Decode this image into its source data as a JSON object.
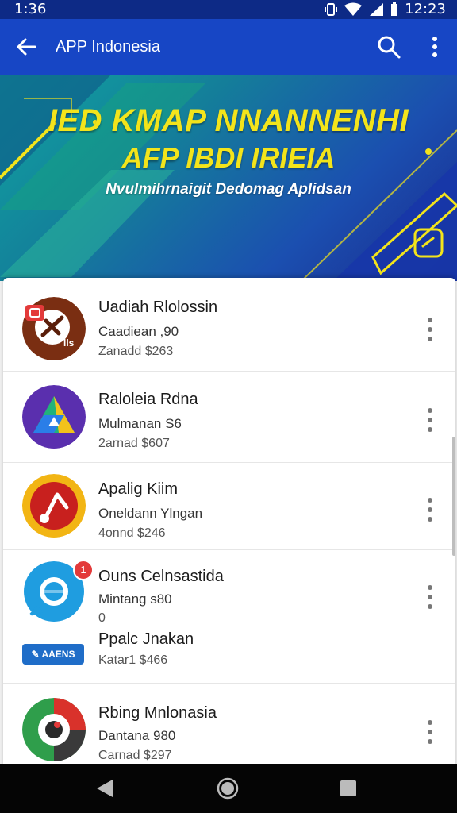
{
  "status_bar": {
    "time_left": "1:36",
    "time_right": "12:23",
    "icons": [
      "vibrate-icon",
      "wifi-icon",
      "signal-icon",
      "battery-icon"
    ]
  },
  "toolbar": {
    "title": "APP Indonesia",
    "back_icon": "arrow-left-icon",
    "search_icon": "search-icon",
    "more_icon": "more-vert-icon"
  },
  "hero": {
    "headline_line1": "IED KMAP NNANNENHI",
    "headline_line2": "AFP IBDI IRIEIA",
    "subtitle": "Nvulmihrnaigit Dedomag Aplidsan"
  },
  "apps": [
    {
      "name": "Uadiah Rlolossin",
      "line2": "Caadiean ,90",
      "line3": "Zanadd $263",
      "icon": "app-icon-brown",
      "badge": "notification-badge"
    },
    {
      "name": "Raloleia Rdna",
      "line2": "Mulmanan S6",
      "line3": "2arnad $607",
      "icon": "app-icon-triangle"
    },
    {
      "name": "Apalig Kiim",
      "line2": "Oneldann Ylngan",
      "line3": "4onnd $246",
      "icon": "app-icon-music"
    },
    {
      "name": "Ouns Celnsastida",
      "line2": "Mintang s80",
      "line3": "0",
      "line4": "Ppalc Jnakan",
      "line5": "Katar1 $466",
      "icon": "app-icon-chat",
      "badge_count": "1",
      "tag_label": "AAENS"
    },
    {
      "name": "Rbing Mnlonasia",
      "line2": "Dantana 980",
      "line3": "Carnad $297",
      "icon": "app-icon-camera"
    }
  ],
  "colors": {
    "toolbar": "#1746c5",
    "statusbar": "#0d2a86",
    "accent_yellow": "#f3e41b"
  },
  "nav": {
    "back_icon": "nav-back-icon",
    "home_icon": "nav-home-icon",
    "recent_icon": "nav-recent-icon"
  }
}
